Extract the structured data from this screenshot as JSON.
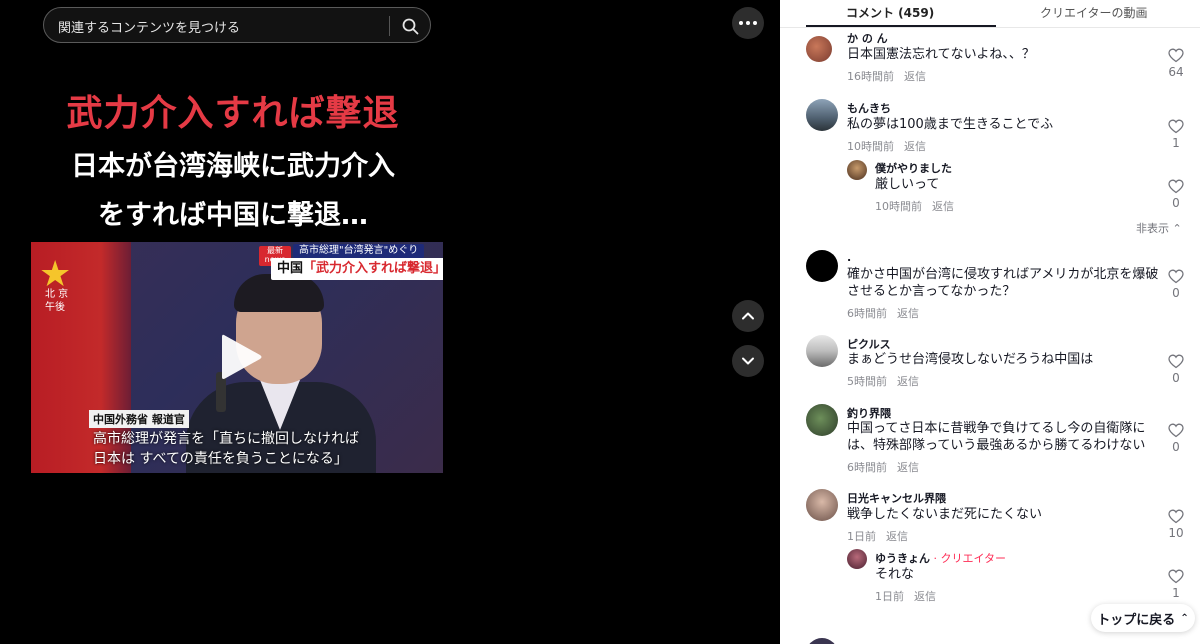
{
  "search": {
    "placeholder": "関連するコンテンツを見つける"
  },
  "video": {
    "caption_red": "武力介入すれば撃退",
    "caption_line1": "日本が台湾海峡に武力介入",
    "caption_line2": "をすれば中国に撃退…",
    "frame": {
      "location_line1": "北 京",
      "location_line2": "午後",
      "news_badge": "最新 news",
      "news_top": "高市総理\"台湾発言\"めぐり",
      "news_main_prefix": "中国",
      "news_main_quote": "「武力介入すれば撃退」",
      "lower_title": "中国外務省 報道官",
      "lower_line1": "高市総理が発言を「直ちに撤回しなければ",
      "lower_line2": "日本は すべての責任を負うことになる」"
    }
  },
  "tabs": {
    "comments": "コメント (459)",
    "creator": "クリエイターの動画"
  },
  "comments": [
    {
      "user": "か の ん",
      "text": "日本国憲法忘れてないよね、、？",
      "time": "16時間前",
      "reply": "返信",
      "likes": "64"
    },
    {
      "user": "もんきち",
      "text": "私の夢は100歳まで生きることでふ",
      "time": "10時間前",
      "reply": "返信",
      "likes": "1"
    },
    {
      "user": "僕がやりました",
      "text": "厳しいって",
      "time": "10時間前",
      "reply": "返信",
      "likes": "0"
    },
    {
      "user": ".",
      "text": "確かさ中国が台湾に侵攻すればアメリカが北京を爆破",
      "text2": "させるとか言ってなかった？",
      "time": "6時間前",
      "reply": "返信",
      "likes": "0"
    },
    {
      "user": "ピクルス",
      "text": "まぁどうせ台湾侵攻しないだろうね中国は",
      "time": "5時間前",
      "reply": "返信",
      "likes": "0"
    },
    {
      "user": "釣り界隈",
      "text": "中国ってさ日本に昔戦争で負けてるし今の自衛隊に",
      "text2": "は、特殊部隊っていう最強あるから勝てるわけない",
      "time": "6時間前",
      "reply": "返信",
      "likes": "0"
    },
    {
      "user": "日光キャンセル界隈",
      "text": "戦争したくないまだ死にたくない",
      "time": "1日前",
      "reply": "返信",
      "likes": "10"
    },
    {
      "user": "ゆうきょん",
      "creator_tag": " · クリエイター",
      "text": "それな",
      "time": "1日前",
      "reply": "返信",
      "likes": "1"
    }
  ],
  "hide_replies": "非表示",
  "back_to_top": "トップに戻る",
  "colors": {
    "accent": "#fe2c55",
    "caption_red": "#e53a45",
    "video_bg": "#000000"
  }
}
